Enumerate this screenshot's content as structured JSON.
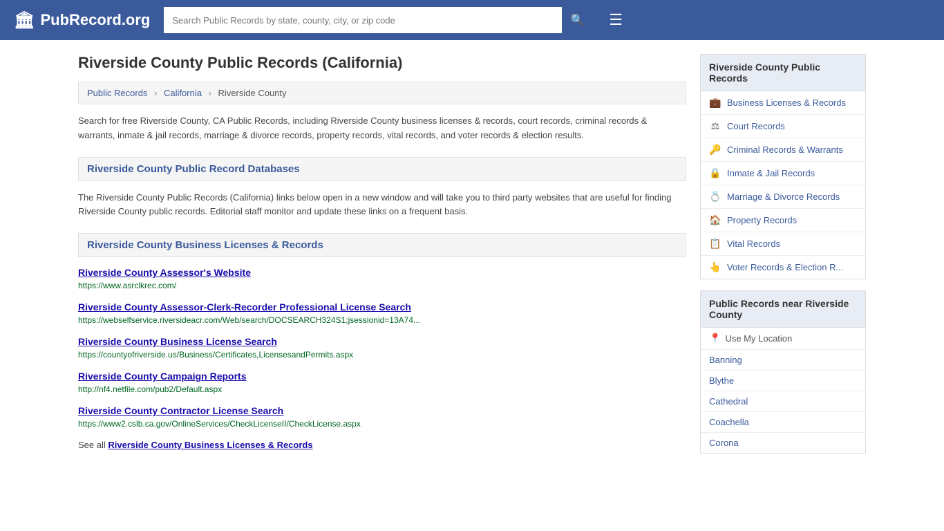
{
  "header": {
    "logo_icon": "🏛",
    "logo_text": "PubRecord.org",
    "search_placeholder": "Search Public Records by state, county, city, or zip code",
    "search_icon": "🔍",
    "menu_icon": "☰"
  },
  "page": {
    "title": "Riverside County Public Records (California)",
    "breadcrumb": {
      "items": [
        "Public Records",
        "California",
        "Riverside County"
      ]
    },
    "description": "Search for free Riverside County, CA Public Records, including Riverside County business licenses & records, court records, criminal records & warrants, inmate & jail records, marriage & divorce records, property records, vital records, and voter records & election results.",
    "databases_heading": "Riverside County Public Record Databases",
    "databases_description": "The Riverside County Public Records (California) links below open in a new window and will take you to third party websites that are useful for finding Riverside County public records. Editorial staff monitor and update these links on a frequent basis.",
    "business_section": {
      "heading": "Riverside County Business Licenses & Records",
      "records": [
        {
          "title": "Riverside County Assessor's Website",
          "url": "https://www.asrclkrec.com/"
        },
        {
          "title": "Riverside County Assessor-Clerk-Recorder Professional License Search",
          "url": "https://webselfservice.riversideacr.com/Web/search/DOCSEARCH324S1;jsessionid=13A74..."
        },
        {
          "title": "Riverside County Business License Search",
          "url": "https://countyofriverside.us/Business/Certificates,LicensesandPermits.aspx"
        },
        {
          "title": "Riverside County Campaign Reports",
          "url": "http://nf4.netfile.com/pub2/Default.aspx"
        },
        {
          "title": "Riverside County Contractor License Search",
          "url": "https://www2.cslb.ca.gov/OnlineServices/CheckLicenseII/CheckLicense.aspx"
        }
      ],
      "see_all_text": "See all ",
      "see_all_link": "Riverside County Business Licenses & Records"
    }
  },
  "sidebar": {
    "county_box": {
      "title": "Riverside County Public Records",
      "items": [
        {
          "icon": "💼",
          "label": "Business Licenses & Records"
        },
        {
          "icon": "⚖",
          "label": "Court Records"
        },
        {
          "icon": "🔑",
          "label": "Criminal Records & Warrants"
        },
        {
          "icon": "🔒",
          "label": "Inmate & Jail Records"
        },
        {
          "icon": "💍",
          "label": "Marriage & Divorce Records"
        },
        {
          "icon": "🏠",
          "label": "Property Records"
        },
        {
          "icon": "📋",
          "label": "Vital Records"
        },
        {
          "icon": "👆",
          "label": "Voter Records & Election R..."
        }
      ]
    },
    "nearby_box": {
      "title": "Public Records near Riverside County",
      "use_my_location": "Use My Location",
      "cities": [
        "Banning",
        "Blythe",
        "Cathedral",
        "Coachella",
        "Corona"
      ]
    }
  }
}
